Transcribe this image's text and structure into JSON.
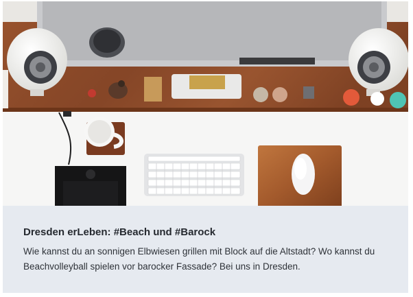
{
  "card": {
    "title": "Dresden erLeben: #Beach und #Barock",
    "description": "Wie kannst du an sonnigen Elbwiesen grillen mit Block auf die Altstadt? Wo kannst du Beachvolleyball spielen vor barocker Fassade? Bei uns in Dresden."
  },
  "colors": {
    "caption_background": "#e6eaf0",
    "desk_wood": "#8a4a2a",
    "desk_surface": "#f4f3f1"
  },
  "photo_scene": {
    "icons": [
      "monitor-icon",
      "keyboard-icon",
      "mouse-icon",
      "speaker-icon",
      "mug-icon",
      "drawing-tablet-icon",
      "mouse-pad-icon"
    ]
  }
}
